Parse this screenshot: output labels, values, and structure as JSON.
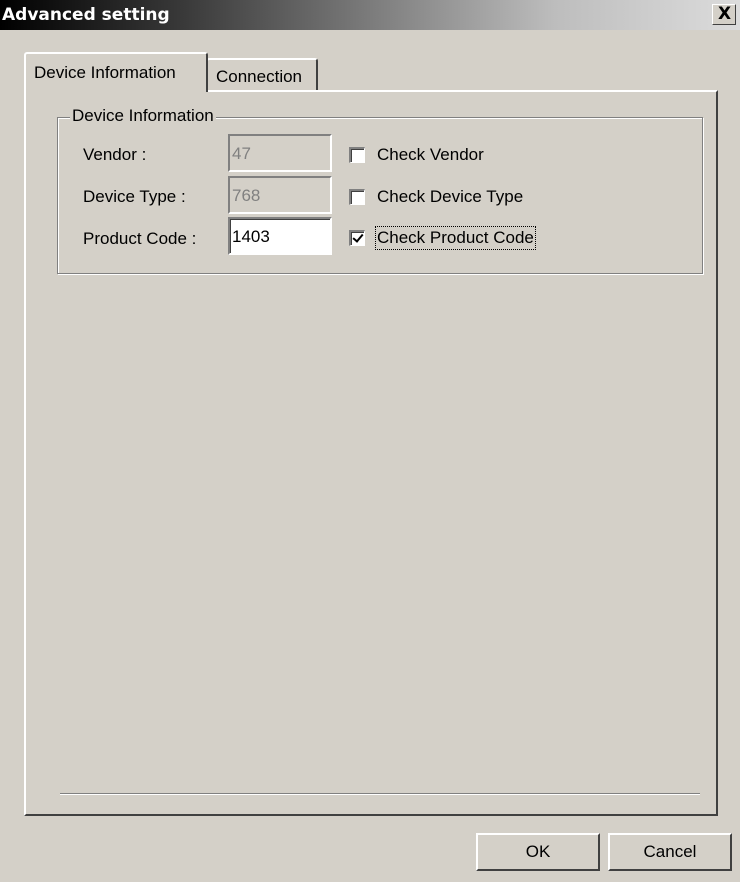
{
  "window": {
    "title": "Advanced setting",
    "close_label": "X"
  },
  "tabs": [
    {
      "label": "Device Information",
      "active": true
    },
    {
      "label": "Connection",
      "active": false
    }
  ],
  "group": {
    "legend": "Device Information",
    "rows": [
      {
        "label": "Vendor :",
        "value": "47",
        "enabled": false,
        "check_label": "Check Vendor",
        "checked": false
      },
      {
        "label": "Device Type :",
        "value": "768",
        "enabled": false,
        "check_label": "Check Device Type",
        "checked": false
      },
      {
        "label": "Product Code :",
        "value": "1403",
        "enabled": true,
        "check_label": "Check Product Code",
        "checked": true
      }
    ]
  },
  "buttons": {
    "ok": "OK",
    "cancel": "Cancel"
  }
}
